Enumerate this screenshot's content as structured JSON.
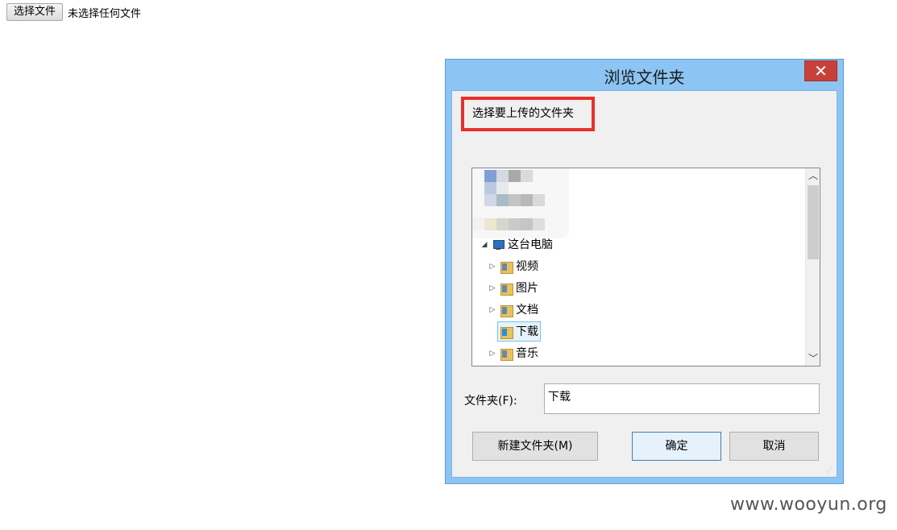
{
  "page": {
    "choose_button_label": "选择文件",
    "no_file_text": "未选择任何文件",
    "watermark": "www.wooyun.org"
  },
  "dialog": {
    "title": "浏览文件夹",
    "close_glyph": "✕",
    "description": "选择要上传的文件夹",
    "tree": {
      "items": [
        {
          "label": "这台电脑",
          "icon": "computer-icon",
          "expanded": true
        },
        {
          "label": "视频",
          "icon": "folder-videos-icon"
        },
        {
          "label": "图片",
          "icon": "folder-pictures-icon"
        },
        {
          "label": "文档",
          "icon": "folder-documents-icon"
        },
        {
          "label": "下载",
          "icon": "folder-downloads-icon",
          "selected": true
        },
        {
          "label": "音乐",
          "icon": "folder-music-icon"
        }
      ]
    },
    "folder_label": "文件夹(F):",
    "folder_value": "下载",
    "new_folder_button": "新建文件夹(M)",
    "ok_button": "确定",
    "cancel_button": "取消"
  },
  "colors": {
    "dialog_frame": "#8cc4f3",
    "close_button": "#c7403a",
    "highlight_box": "#e8302a"
  }
}
